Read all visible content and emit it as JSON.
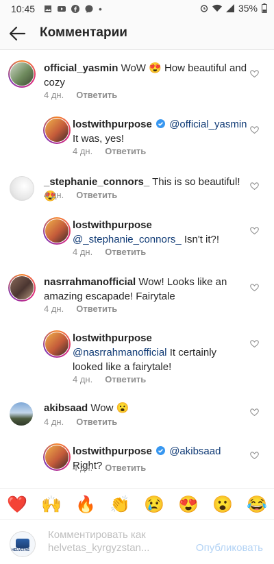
{
  "status": {
    "time": "10:45",
    "battery": "35%"
  },
  "header": {
    "title": "Комментарии"
  },
  "comments": [
    {
      "user": "official_yasmin",
      "text": "WoW 😍 How beautiful and cozy",
      "age": "4 дн.",
      "reply": "Ответить"
    },
    {
      "user": "lostwithpurpose",
      "mention": "@official_yasmin",
      "text": "It was, yes!",
      "age": "4 дн.",
      "reply": "Ответить"
    },
    {
      "user": "_stephanie_connors_",
      "text": "This is so beautiful!😍",
      "age": "4 дн.",
      "reply": "Ответить"
    },
    {
      "user": "lostwithpurpose",
      "mention": "@_stephanie_connors_",
      "text": "Isn't it?!",
      "age": "4 дн.",
      "reply": "Ответить"
    },
    {
      "user": "nasrrahmanofficial",
      "text": "Wow! Looks like an amazing escapade! Fairytale",
      "age": "4 дн.",
      "reply": "Ответить"
    },
    {
      "user": "lostwithpurpose",
      "mention": "@nasrrahmanofficial",
      "text": "It certainly looked like a fairytale!",
      "age": "4 дн.",
      "reply": "Ответить"
    },
    {
      "user": "akibsaad",
      "text": "Wow 😮",
      "age": "4 дн.",
      "reply": "Ответить"
    },
    {
      "user": "lostwithpurpose",
      "mention": "@akibsaad",
      "text": "Right?",
      "age": "4 дн.",
      "reply": "Ответить"
    }
  ],
  "emojis": [
    "❤️",
    "🙌",
    "🔥",
    "👏",
    "😢",
    "😍",
    "😮",
    "😂"
  ],
  "composer": {
    "placeholder_line1": "Комментировать как",
    "placeholder_line2": "helvetas_kyrgyzstan...",
    "post_label": "Опубликовать",
    "avatar_text": "HELVETAS"
  },
  "colors": {
    "mention": "#0f3a75",
    "verified": "#3897f0",
    "post_disabled": "#b3d3f5"
  }
}
